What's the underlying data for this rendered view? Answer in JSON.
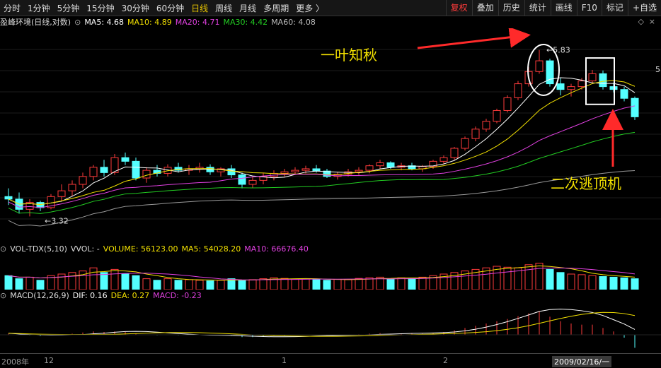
{
  "toolbar": {
    "periods": [
      "分时",
      "1分钟",
      "5分钟",
      "15分钟",
      "30分钟",
      "60分钟",
      "日线",
      "周线",
      "月线",
      "多周期",
      "更多 〉"
    ],
    "active_period": "日线",
    "right_buttons": [
      "复权",
      "叠加",
      "历史",
      "统计",
      "画线",
      "F10",
      "标记",
      "+自选"
    ],
    "highlight_button": "复权"
  },
  "price_panel": {
    "title": "盈峰环境(日线,对数)",
    "ma": [
      {
        "label": "MA5: 4.68",
        "color": "#ffffff"
      },
      {
        "label": "MA10: 4.89",
        "color": "#f2e000"
      },
      {
        "label": "MA20: 4.71",
        "color": "#e040e0"
      },
      {
        "label": "MA30: 4.42",
        "color": "#22cc22"
      },
      {
        "label": "MA60: 4.08",
        "color": "#9a9a9a"
      }
    ],
    "high_label": "5.83",
    "low_label": "3.32",
    "right_edge_label": "5",
    "annotation_1": "一叶知秋",
    "annotation_2": "二次逃顶机"
  },
  "volume_panel": {
    "title": "VOL-TDX(5,10)",
    "vvol": "VVOL: -",
    "volume": "VOLUME: 56123.00",
    "ma5": "MA5: 54028.20",
    "ma10": "MA10: 66676.40"
  },
  "macd_panel": {
    "title": "MACD(12,26,9)",
    "dif": "DIF: 0.16",
    "dea": "DEA: 0.27",
    "macd": "MACD: -0.23"
  },
  "x_axis": {
    "labels": [
      "2008年",
      "12",
      "1",
      "2"
    ],
    "current_date": "2009/02/16/一"
  },
  "colors": {
    "up": "#ff3b3b",
    "down": "#54ffff",
    "ma5": "#ffffff",
    "ma10": "#f2e000",
    "ma20": "#e040e0",
    "ma30": "#22cc22",
    "ma60": "#9a9a9a",
    "annotation": "#f2e000",
    "arrow": "#ff2a2a"
  },
  "chart_data": {
    "type": "candlestick",
    "candles": [
      [
        3.55,
        3.65,
        3.45,
        3.52
      ],
      [
        3.52,
        3.6,
        3.35,
        3.4
      ],
      [
        3.4,
        3.52,
        3.32,
        3.48
      ],
      [
        3.48,
        3.5,
        3.38,
        3.42
      ],
      [
        3.42,
        3.58,
        3.4,
        3.55
      ],
      [
        3.55,
        3.7,
        3.5,
        3.62
      ],
      [
        3.62,
        3.75,
        3.55,
        3.7
      ],
      [
        3.7,
        3.85,
        3.65,
        3.8
      ],
      [
        3.8,
        3.95,
        3.75,
        3.92
      ],
      [
        3.92,
        4.02,
        3.8,
        3.85
      ],
      [
        3.85,
        4.1,
        3.82,
        4.05
      ],
      [
        4.05,
        4.12,
        3.95,
        4.0
      ],
      [
        4.0,
        4.05,
        3.75,
        3.78
      ],
      [
        3.78,
        3.92,
        3.72,
        3.88
      ],
      [
        3.88,
        3.95,
        3.8,
        3.84
      ],
      [
        3.84,
        3.96,
        3.8,
        3.92
      ],
      [
        3.92,
        3.98,
        3.85,
        3.88
      ],
      [
        3.88,
        3.95,
        3.82,
        3.9
      ],
      [
        3.9,
        3.98,
        3.85,
        3.92
      ],
      [
        3.92,
        3.96,
        3.82,
        3.86
      ],
      [
        3.86,
        3.92,
        3.8,
        3.9
      ],
      [
        3.9,
        3.95,
        3.78,
        3.82
      ],
      [
        3.82,
        3.85,
        3.65,
        3.7
      ],
      [
        3.7,
        3.8,
        3.66,
        3.75
      ],
      [
        3.75,
        3.85,
        3.7,
        3.8
      ],
      [
        3.8,
        3.88,
        3.75,
        3.84
      ],
      [
        3.84,
        3.9,
        3.8,
        3.86
      ],
      [
        3.86,
        3.92,
        3.82,
        3.88
      ],
      [
        3.88,
        3.94,
        3.84,
        3.9
      ],
      [
        3.9,
        3.95,
        3.85,
        3.87
      ],
      [
        3.87,
        3.9,
        3.78,
        3.8
      ],
      [
        3.8,
        3.86,
        3.76,
        3.83
      ],
      [
        3.83,
        3.9,
        3.8,
        3.86
      ],
      [
        3.86,
        3.92,
        3.82,
        3.88
      ],
      [
        3.88,
        3.96,
        3.84,
        3.94
      ],
      [
        3.94,
        4.02,
        3.9,
        3.98
      ],
      [
        3.98,
        4.0,
        3.9,
        3.92
      ],
      [
        3.92,
        3.98,
        3.88,
        3.94
      ],
      [
        3.94,
        3.98,
        3.88,
        3.9
      ],
      [
        3.9,
        3.95,
        3.86,
        3.93
      ],
      [
        3.93,
        4.02,
        3.9,
        4.0
      ],
      [
        4.0,
        4.08,
        3.96,
        4.05
      ],
      [
        4.05,
        4.2,
        4.02,
        4.18
      ],
      [
        4.18,
        4.35,
        4.15,
        4.32
      ],
      [
        4.32,
        4.5,
        4.28,
        4.46
      ],
      [
        4.46,
        4.62,
        4.42,
        4.58
      ],
      [
        4.58,
        4.78,
        4.55,
        4.75
      ],
      [
        4.75,
        5.0,
        4.72,
        4.96
      ],
      [
        4.96,
        5.25,
        4.92,
        5.2
      ],
      [
        5.2,
        5.5,
        5.15,
        5.42
      ],
      [
        5.42,
        5.83,
        5.38,
        5.62
      ],
      [
        5.62,
        5.66,
        5.15,
        5.2
      ],
      [
        5.2,
        5.3,
        5.0,
        5.1
      ],
      [
        5.1,
        5.2,
        4.98,
        5.15
      ],
      [
        5.15,
        5.3,
        5.1,
        5.25
      ],
      [
        5.25,
        5.45,
        5.2,
        5.38
      ],
      [
        5.38,
        5.44,
        5.1,
        5.15
      ],
      [
        5.15,
        5.22,
        5.05,
        5.1
      ],
      [
        5.1,
        5.15,
        4.9,
        4.95
      ],
      [
        4.95,
        4.98,
        4.6,
        4.65
      ]
    ],
    "volume_ratio": [
      0.45,
      0.35,
      0.4,
      0.3,
      0.45,
      0.5,
      0.55,
      0.6,
      0.7,
      0.55,
      0.65,
      0.5,
      0.45,
      0.35,
      0.3,
      0.35,
      0.3,
      0.32,
      0.3,
      0.28,
      0.3,
      0.35,
      0.3,
      0.32,
      0.35,
      0.38,
      0.36,
      0.34,
      0.35,
      0.32,
      0.3,
      0.33,
      0.32,
      0.36,
      0.38,
      0.4,
      0.35,
      0.38,
      0.36,
      0.4,
      0.45,
      0.5,
      0.55,
      0.6,
      0.65,
      0.7,
      0.75,
      0.72,
      0.7,
      0.8,
      0.85,
      0.65,
      0.55,
      0.5,
      0.48,
      0.45,
      0.42,
      0.4,
      0.38,
      0.35
    ],
    "macd": [
      0.02,
      0.0,
      -0.01,
      -0.02,
      -0.01,
      0.0,
      0.02,
      0.04,
      0.06,
      0.05,
      0.06,
      0.05,
      0.02,
      0.0,
      -0.01,
      0.0,
      -0.01,
      0.0,
      0.0,
      -0.01,
      -0.01,
      -0.02,
      -0.04,
      -0.04,
      -0.03,
      -0.02,
      -0.01,
      0.0,
      0.0,
      0.0,
      -0.01,
      -0.01,
      0.0,
      0.01,
      0.02,
      0.03,
      0.02,
      0.02,
      0.02,
      0.02,
      0.03,
      0.05,
      0.08,
      0.12,
      0.16,
      0.2,
      0.24,
      0.28,
      0.33,
      0.38,
      0.42,
      0.32,
      0.24,
      0.2,
      0.18,
      0.18,
      0.12,
      0.06,
      -0.05,
      -0.23
    ],
    "ylim_log": [
      3.1,
      6.2
    ]
  }
}
